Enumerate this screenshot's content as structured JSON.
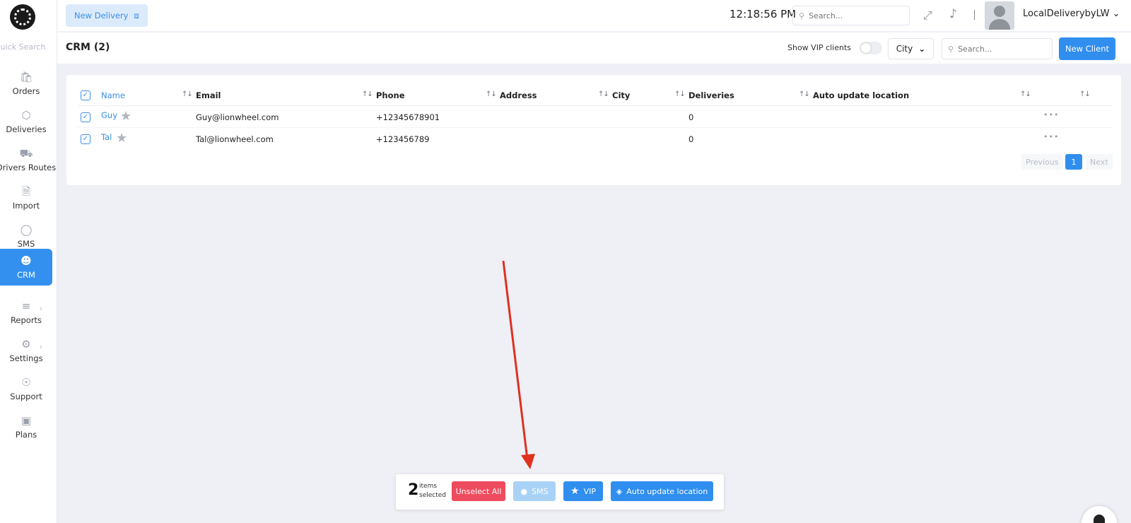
{
  "sidebar": {
    "quick_search": "Quick Search",
    "items": [
      {
        "label": "Orders",
        "icon": "shopping-bag-icon"
      },
      {
        "label": "Deliveries",
        "icon": "box-icon"
      },
      {
        "label": "Drivers Routes",
        "icon": "truck-icon"
      },
      {
        "label": "Import",
        "icon": "file-import-icon"
      },
      {
        "label": "SMS",
        "icon": "chat-bubble-icon"
      },
      {
        "label": "CRM",
        "icon": "users-icon",
        "active": true
      },
      {
        "label": "Reports",
        "icon": "bar-chart-icon"
      },
      {
        "label": "Settings",
        "icon": "gears-icon"
      },
      {
        "label": "Support",
        "icon": "lifebuoy-icon"
      },
      {
        "label": "Plans",
        "icon": "credit-card-icon"
      }
    ]
  },
  "topbar": {
    "new_delivery_label": "New Delivery",
    "clock": "12:18:56 PM",
    "search_placeholder": "Search...",
    "username": "LocalDeliverybyLW"
  },
  "header": {
    "title": "CRM (2)",
    "vip_toggle_label": "Show VIP clients",
    "city_label": "City",
    "search_placeholder": "Search...",
    "new_client_label": "New Client"
  },
  "table": {
    "columns": [
      "Name",
      "Email",
      "Phone",
      "Address",
      "City",
      "Deliveries",
      "Auto update location"
    ],
    "rows": [
      {
        "name": "Guy",
        "email": "Guy@lionwheel.com",
        "phone": "+12345678901",
        "address": "",
        "city": "",
        "deliveries": "0",
        "auto_update": ""
      },
      {
        "name": "Tal",
        "email": "Tal@lionwheel.com",
        "phone": "+123456789",
        "address": "",
        "city": "",
        "deliveries": "0",
        "auto_update": ""
      }
    ],
    "pagination": {
      "previous": "Previous",
      "current": "1",
      "next": "Next"
    }
  },
  "action_bar": {
    "count": "2",
    "count_label_1": "items",
    "count_label_2": "selected",
    "unselect_label": "Unselect All",
    "sms_label": "SMS",
    "vip_label": "VIP",
    "auto_update_label": "Auto update location"
  },
  "colors": {
    "accent": "#2f8eee",
    "danger": "#ef4b5e",
    "annotation_arrow": "#e0301e"
  }
}
